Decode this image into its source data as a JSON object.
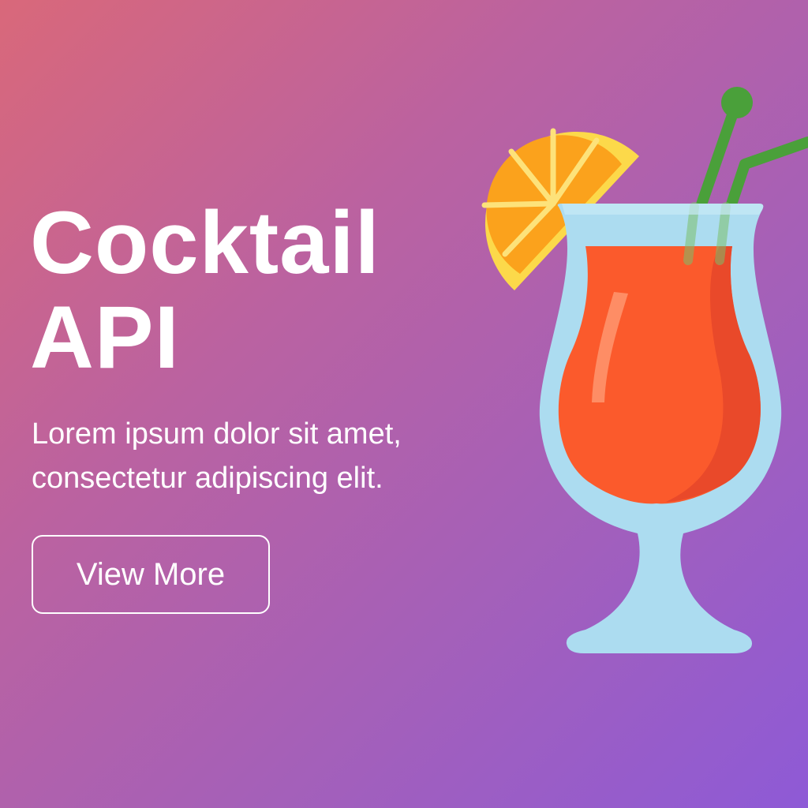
{
  "hero": {
    "title_line1": "Cocktail",
    "title_line2": "API",
    "subtitle_line1": "Lorem ipsum dolor sit amet,",
    "subtitle_line2": "consectetur adipiscing elit.",
    "button_label": "View More"
  },
  "illustration": {
    "icon": "cocktail-glass-icon",
    "garnish_icon": "orange-slice-icon",
    "straw_icon": "straw-icon"
  },
  "colors": {
    "gradient_start": "#d9687a",
    "gradient_end": "#8e5ad6",
    "text": "#ffffff",
    "glass": "#acdcf0",
    "drink": "#fb5a2c",
    "orange": "#fba21c",
    "straw": "#4aa03a"
  }
}
